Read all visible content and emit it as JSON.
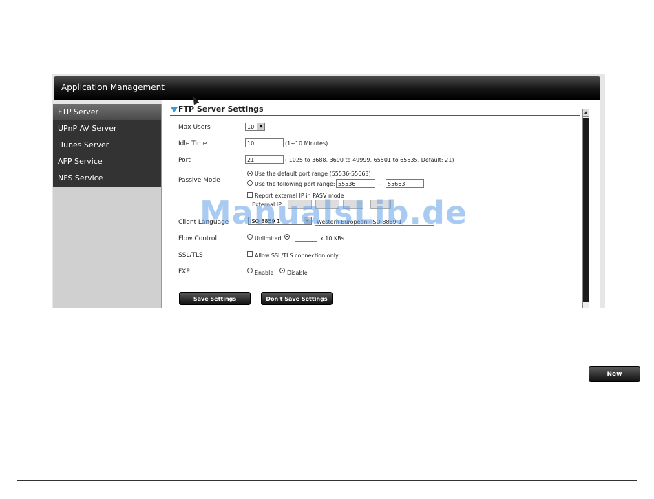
{
  "window": {
    "title": "Application Management"
  },
  "sidebar": {
    "items": [
      {
        "label": "FTP Server",
        "active": true
      },
      {
        "label": "UPnP AV Server",
        "active": false
      },
      {
        "label": "iTunes Server",
        "active": false
      },
      {
        "label": "AFP Service",
        "active": false
      },
      {
        "label": "NFS Service",
        "active": false
      }
    ]
  },
  "section": {
    "title": "FTP Server Settings"
  },
  "form": {
    "max_users": {
      "label": "Max Users",
      "value": "10"
    },
    "idle_time": {
      "label": "Idle Time",
      "value": "10",
      "hint": "(1~10 Minutes)"
    },
    "port": {
      "label": "Port",
      "value": "21",
      "hint": "( 1025 to 3688, 3690 to 49999, 65501 to 65535, Default: 21)"
    },
    "passive_mode": {
      "label": "Passive Mode",
      "option_default": "Use the default port range (55536-55663)",
      "option_custom": "Use the following port range:",
      "range_from": "55536",
      "range_sep": "~",
      "range_to": "55663",
      "report_external": "Report external IP in PASV mode",
      "external_ip_label": "External IP :",
      "ip_sep": "."
    },
    "client_language": {
      "label": "Client Language",
      "value": "ISO 8859 1",
      "desc": "Western European (ISO 8859-1)"
    },
    "flow_control": {
      "label": "Flow Control",
      "option_unlimited": "Unlimited",
      "unit": "x 10 KBs"
    },
    "ssl_tls": {
      "label": "SSL/TLS",
      "option": "Allow SSL/TLS connection only"
    },
    "fxp": {
      "label": "FXP",
      "option_enable": "Enable",
      "option_disable": "Disable"
    }
  },
  "buttons": {
    "save": "Save Settings",
    "dont_save": "Don't Save Settings",
    "new": "New"
  },
  "watermark": "ManualsLib.de"
}
